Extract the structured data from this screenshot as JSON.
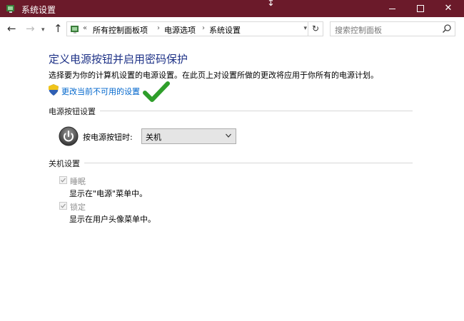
{
  "window": {
    "title": "系统设置"
  },
  "nav": {
    "breadcrumb": [
      "所有控制面板项",
      "电源选项",
      "系统设置"
    ],
    "search_placeholder": "搜索控制面板"
  },
  "content": {
    "title": "定义电源按钮并启用密码保护",
    "description": "选择要为你的计算机设置的电源设置。在此页上对设置所做的更改将应用于你所有的电源计划。",
    "change_link": "更改当前不可用的设置",
    "power_section": {
      "label": "电源按钮设置",
      "action_label": "按电源按钮时:",
      "action_value": "关机"
    },
    "shutdown_section": {
      "label": "关机设置",
      "items": [
        {
          "label": "睡眠",
          "description": "显示在\"电源\"菜单中。",
          "checked": true,
          "disabled": true
        },
        {
          "label": "锁定",
          "description": "显示在用户头像菜单中。",
          "checked": true,
          "disabled": true
        }
      ]
    }
  },
  "colors": {
    "titlebar": "#6b1a2a",
    "title_text": "#1e3287",
    "link": "#0066cc",
    "checkmark": "#2e9e2a"
  }
}
